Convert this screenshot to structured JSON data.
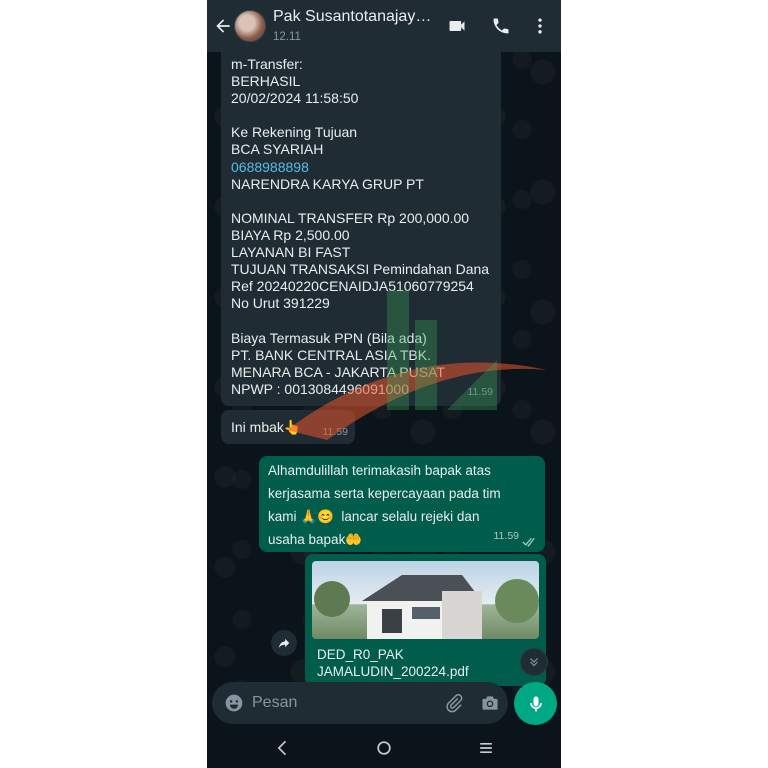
{
  "header": {
    "contact_name": "Pak Susantotanajay…",
    "status": "12.11"
  },
  "messages": {
    "transfer": {
      "lines": [
        "m-Transfer:",
        "BERHASIL",
        "20/02/2024 11:58:50",
        "",
        "Ke Rekening Tujuan",
        "BCA SYARIAH",
        "0688988898",
        "NARENDRA KARYA GRUP PT",
        "",
        "NOMINAL TRANSFER Rp 200,000.00",
        "BIAYA Rp 2,500.00",
        "LAYANAN BI FAST",
        "TUJUAN TRANSAKSI Pemindahan Dana",
        "Ref 20240220CENAIDJA51060779254",
        "No Urut 391229",
        "",
        "Biaya Termasuk PPN (Bila ada)",
        "PT. BANK CENTRAL ASIA TBK.",
        "MENARA BCA - JAKARTA PUSAT",
        "NPWP : 001308449609100​0"
      ],
      "time": "11.59"
    },
    "ini_mbak": {
      "text": "Ini mbak👆",
      "time": "11.59"
    },
    "reply": {
      "lines": [
        "Alhamdulillah terimakasih bapak atas",
        "kerjasama serta kepercayaan pada tim",
        "kami 🙏😊  lancar selalu rejeki dan",
        "usaha bapak🤲"
      ],
      "time": "11.59"
    },
    "file": {
      "name_line1": "DED_R0_PAK",
      "name_line2": "JAMALUDIN_200224.pdf"
    }
  },
  "input": {
    "placeholder": "Pesan"
  },
  "icons": {
    "back": "arrow-left-icon",
    "video": "video-call-icon",
    "call": "phone-icon",
    "menu": "more-vert-icon",
    "emoji": "emoji-icon",
    "attach": "paperclip-icon",
    "camera": "camera-icon",
    "mic": "microphone-icon",
    "forward": "forward-icon",
    "scroll": "chevron-down-icon"
  },
  "colors": {
    "background": "#0b141a",
    "header": "#1f2c34",
    "incoming": "#202c33",
    "outgoing": "#005c4b",
    "accent": "#00a884",
    "link": "#53bdeb"
  }
}
